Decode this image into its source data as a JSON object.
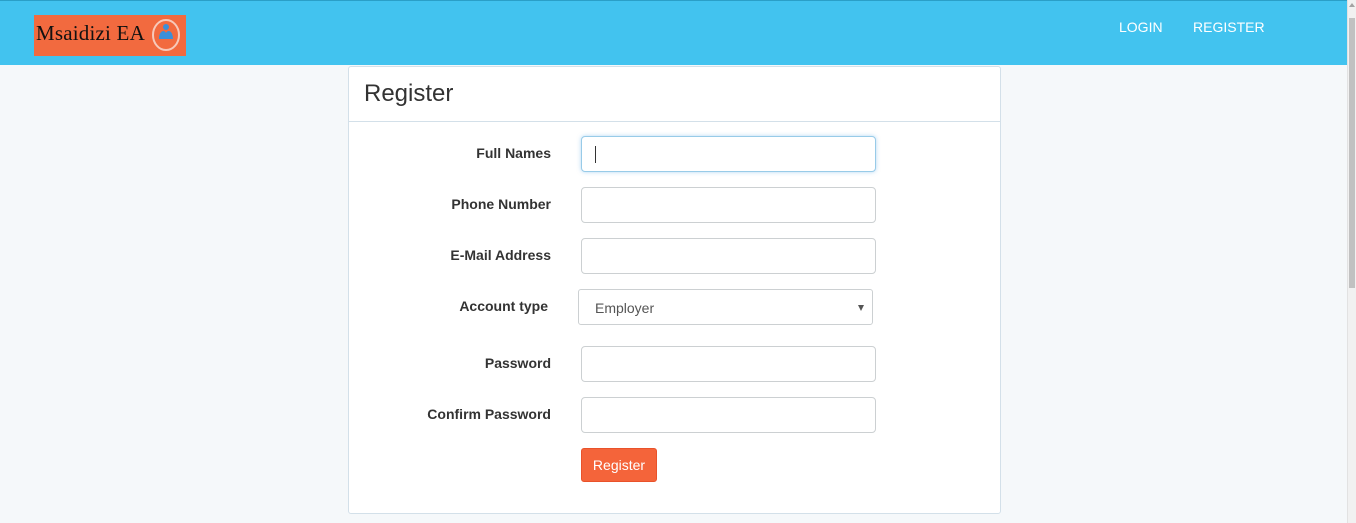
{
  "brand": {
    "name": "Msaidizi EA",
    "accent_color": "#f26a3f",
    "emblem_icon": "hands-heart-icon"
  },
  "nav": {
    "login_label": "LOGIN",
    "register_label": "REGISTER",
    "bar_color": "#42c3ef"
  },
  "form": {
    "title": "Register",
    "fields": {
      "full_names": {
        "label": "Full Names",
        "value": ""
      },
      "phone_number": {
        "label": "Phone Number",
        "value": ""
      },
      "email": {
        "label": "E-Mail Address",
        "value": ""
      },
      "account_type": {
        "label": "Account type",
        "selected": "Employer"
      },
      "password": {
        "label": "Password",
        "value": ""
      },
      "confirm_password": {
        "label": "Confirm Password",
        "value": ""
      }
    },
    "submit_label": "Register",
    "submit_color": "#f4643a"
  }
}
